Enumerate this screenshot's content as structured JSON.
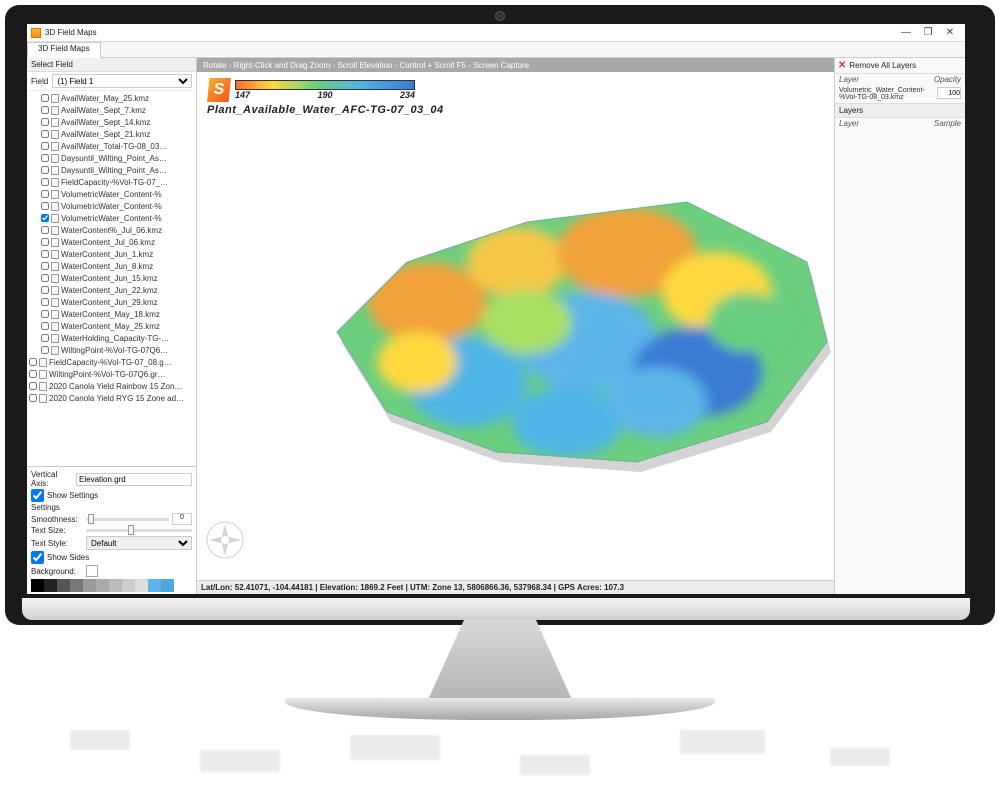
{
  "window": {
    "title": "3D Field Maps"
  },
  "tab": "3D Field Maps",
  "sidebar": {
    "select_field_label": "Select Field",
    "field_label": "Field",
    "field_value": "(1) Field 1",
    "tree": [
      {
        "label": "AvailWater_May_25.kmz",
        "checked": false
      },
      {
        "label": "AvailWater_Sept_7.kmz",
        "checked": false
      },
      {
        "label": "AvailWater_Sept_14.kmz",
        "checked": false
      },
      {
        "label": "AvailWater_Sept_21.kmz",
        "checked": false
      },
      {
        "label": "AvailWater_Total-TG-08_03…",
        "checked": false
      },
      {
        "label": "Daysuntil_Wilting_Point_As…",
        "checked": false
      },
      {
        "label": "Daysuntil_Wilting_Point_As…",
        "checked": false
      },
      {
        "label": "FieldCapacity-%Vol-TG-07_…",
        "checked": false
      },
      {
        "label": "VolumetricWater_Content-%",
        "checked": false
      },
      {
        "label": "VolumetricWater_Content-%",
        "checked": false
      },
      {
        "label": "VolumetricWater_Content-%",
        "checked": true
      },
      {
        "label": "WaterContent%_Jul_06.kmz",
        "checked": false
      },
      {
        "label": "WaterContent_Jul_06.kmz",
        "checked": false
      },
      {
        "label": "WaterContent_Jun_1.kmz",
        "checked": false
      },
      {
        "label": "WaterContent_Jun_8.kmz",
        "checked": false
      },
      {
        "label": "WaterContent_Jun_15.kmz",
        "checked": false
      },
      {
        "label": "WaterContent_Jun_22.kmz",
        "checked": false
      },
      {
        "label": "WaterContent_Jun_29.kmz",
        "checked": false
      },
      {
        "label": "WaterContent_May_18.kmz",
        "checked": false
      },
      {
        "label": "WaterContent_May_25.kmz",
        "checked": false
      },
      {
        "label": "WaterHolding_Capacity-TG-…",
        "checked": false
      },
      {
        "label": "WiltingPoint-%Vol-TG-07Q6…",
        "checked": false
      }
    ],
    "tree_groups": [
      {
        "label": "FieldCapacity-%Vol-TG-07_08.g…",
        "checked": false
      },
      {
        "label": "WiltingPoint-%Vol-TG-07Q6.gr…",
        "checked": false
      },
      {
        "label": "2020 Canola Yield Rainbow 15 Zon…",
        "checked": false
      },
      {
        "label": "2020 Canola Yield RYG 15 Zone ad…",
        "checked": false
      }
    ],
    "vertical_axis_label": "Vertical Axis:",
    "vertical_axis_value": "Elevation.grd",
    "show_settings_label": "Show Settings",
    "show_settings_checked": true,
    "settings_label": "Settings",
    "smoothness_label": "Smoothness:",
    "smoothness_value": "0",
    "text_size_label": "Text Size:",
    "text_style_label": "Text Style:",
    "text_style_value": "Default",
    "show_sides_label": "Show Sides",
    "show_sides_checked": true,
    "background_label": "Background:",
    "palette": [
      "#000000",
      "#222222",
      "#555555",
      "#777777",
      "#999999",
      "#aaaaaa",
      "#bbbbbb",
      "#cccccc",
      "#dddddd",
      "#5bb5e8",
      "#4fa8dc"
    ]
  },
  "viewport": {
    "hint": "Rotate - Right-Click and Drag     Zoom - Scroll     Elevation - Control + Scroll     F5 - Screen Capture",
    "legend": {
      "min": "147",
      "mid": "190",
      "max": "234",
      "title": "Plant_Available_Water_AFC-TG-07_03_04"
    },
    "status": "Lat/Lon: 52.41071, -104.44181 | Elevation: 1869.2 Feet | UTM: Zone 13, 5806866.36, 537968.34 | GPS Acres: 107.3"
  },
  "right": {
    "remove_all": "Remove All Layers",
    "hdr_layer": "Layer",
    "hdr_opacity": "Opacity",
    "active_layer": "Volumetric_Water_Content-%Vol-TG-08_03.kmz",
    "active_opacity": "100",
    "layers_label": "Layers",
    "sample_label": "Sample"
  }
}
